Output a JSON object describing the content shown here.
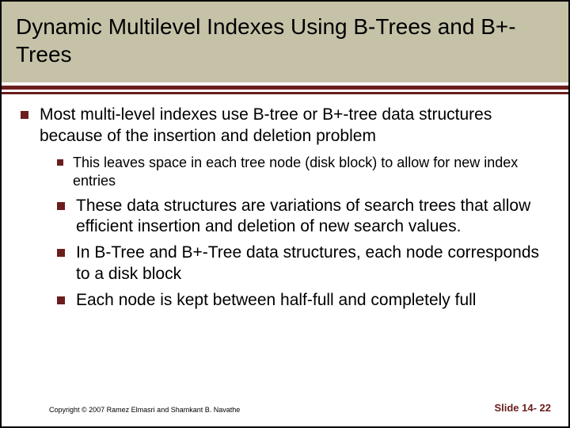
{
  "title": "Dynamic Multilevel Indexes Using B-Trees and B+-Trees",
  "bullets": {
    "p1": "Most multi-level indexes use B-tree or B+-tree data structures because of the insertion and deletion problem",
    "p1_sub1": "This leaves space in each tree node (disk block) to allow for new index entries",
    "p2": "These data structures are variations of search trees that allow efficient insertion and deletion of new search values.",
    "p3": "In B-Tree and B+-Tree data structures, each node corresponds to a disk block",
    "p4": "Each node is kept between half-full and completely full"
  },
  "footer": {
    "copyright": "Copyright © 2007 Ramez Elmasri and Shamkant B. Navathe",
    "slide_label": "Slide 14- 22"
  }
}
